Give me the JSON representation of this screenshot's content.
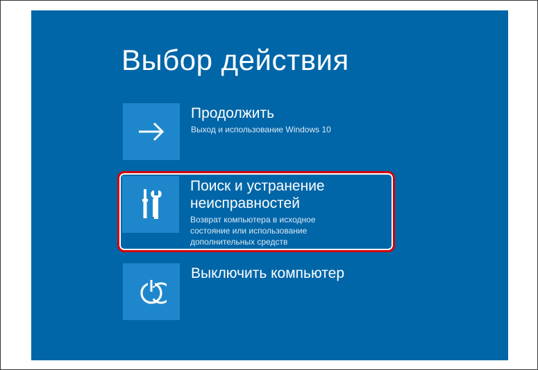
{
  "page_title": "Выбор действия",
  "options": {
    "continue": {
      "title": "Продолжить",
      "subtitle": "Выход и использование Windows 10"
    },
    "troubleshoot": {
      "title": "Поиск и устранение неисправностей",
      "subtitle": "Возврат компьютера в исходное состояние или использование дополнительных средств"
    },
    "shutdown": {
      "title": "Выключить компьютер",
      "subtitle": ""
    }
  }
}
